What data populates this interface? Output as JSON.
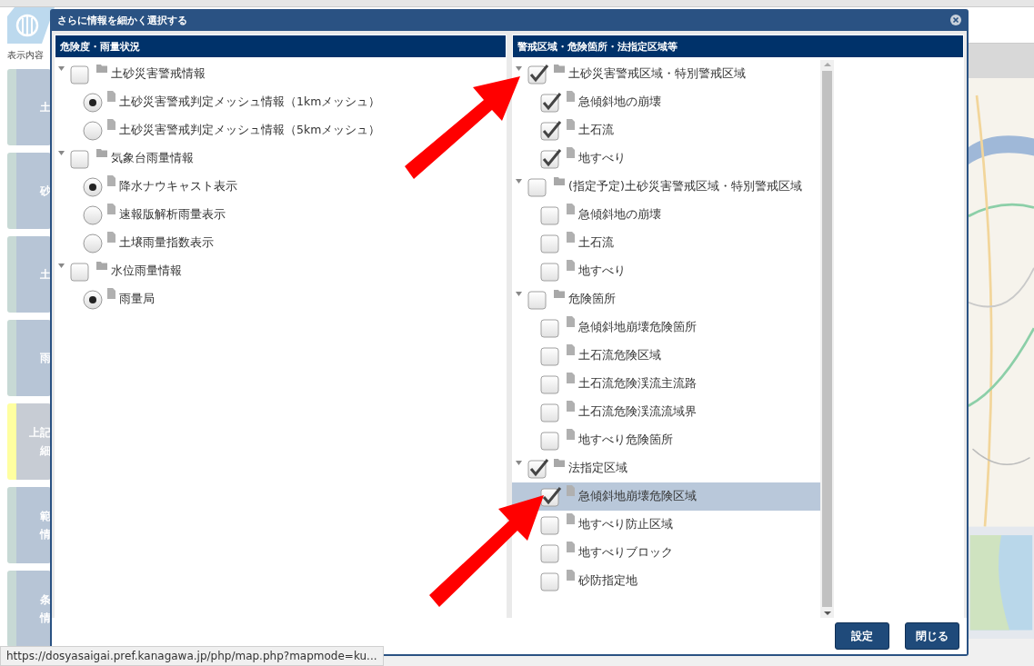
{
  "background": {
    "sidebar_heading": "表示内容",
    "sidebar_items": [
      {
        "lines": [
          "土"
        ],
        "selected": false
      },
      {
        "lines": [
          "砂"
        ],
        "selected": false
      },
      {
        "lines": [
          "土"
        ],
        "selected": false
      },
      {
        "lines": [
          "雨"
        ],
        "selected": false
      },
      {
        "lines": [
          "上記",
          "細"
        ],
        "selected": true
      },
      {
        "lines": [
          "範",
          "情"
        ],
        "selected": false
      },
      {
        "lines": [
          "条",
          "情"
        ],
        "selected": false
      }
    ]
  },
  "dialog": {
    "title": "さらに情報を細かく選択する",
    "panels": [
      {
        "title": "危険度・雨量状況",
        "kind": "plain",
        "tree": [
          {
            "label": "土砂災害警戒情報",
            "checked": false,
            "expanded": true,
            "children": [
              {
                "kind": "radio",
                "label": "土砂災害警戒判定メッシュ情報（1kmメッシュ）",
                "checked": true,
                "selected": false
              },
              {
                "kind": "radio",
                "label": "土砂災害警戒判定メッシュ情報（5kmメッシュ）",
                "checked": false,
                "selected": false
              }
            ]
          },
          {
            "label": "気象台雨量情報",
            "checked": false,
            "expanded": true,
            "children": [
              {
                "kind": "radio",
                "label": "降水ナウキャスト表示",
                "checked": true,
                "selected": false
              },
              {
                "kind": "radio",
                "label": "速報版解析雨量表示",
                "checked": false,
                "selected": false
              },
              {
                "kind": "radio",
                "label": "土壌雨量指数表示",
                "checked": false,
                "selected": false
              }
            ]
          },
          {
            "label": "水位雨量情報",
            "checked": false,
            "expanded": true,
            "children": [
              {
                "kind": "radio",
                "label": "雨量局",
                "checked": true,
                "selected": false
              }
            ]
          }
        ]
      },
      {
        "title": "警戒区域・危険箇所・法指定区域等",
        "kind": "scrolled",
        "tree": [
          {
            "label": "土砂災害警戒区域・特別警戒区域",
            "checked": true,
            "expanded": true,
            "children": [
              {
                "kind": "checkbox",
                "label": "急傾斜地の崩壊",
                "checked": true,
                "selected": false
              },
              {
                "kind": "checkbox",
                "label": "土石流",
                "checked": true,
                "selected": false
              },
              {
                "kind": "checkbox",
                "label": "地すべり",
                "checked": true,
                "selected": false
              }
            ]
          },
          {
            "label": "(指定予定)土砂災害警戒区域・特別警戒区域",
            "checked": false,
            "expanded": true,
            "children": [
              {
                "kind": "checkbox",
                "label": "急傾斜地の崩壊",
                "checked": false,
                "selected": false
              },
              {
                "kind": "checkbox",
                "label": "土石流",
                "checked": false,
                "selected": false
              },
              {
                "kind": "checkbox",
                "label": "地すべり",
                "checked": false,
                "selected": false
              }
            ]
          },
          {
            "label": "危険箇所",
            "checked": false,
            "expanded": true,
            "children": [
              {
                "kind": "checkbox",
                "label": "急傾斜地崩壊危険箇所",
                "checked": false,
                "selected": false
              },
              {
                "kind": "checkbox",
                "label": "土石流危険区域",
                "checked": false,
                "selected": false
              },
              {
                "kind": "checkbox",
                "label": "土石流危険渓流主流路",
                "checked": false,
                "selected": false
              },
              {
                "kind": "checkbox",
                "label": "土石流危険渓流流域界",
                "checked": false,
                "selected": false
              },
              {
                "kind": "checkbox",
                "label": "地すべり危険箇所",
                "checked": false,
                "selected": false
              }
            ]
          },
          {
            "label": "法指定区域",
            "checked": true,
            "expanded": true,
            "children": [
              {
                "kind": "checkbox",
                "label": "急傾斜地崩壊危険区域",
                "checked": true,
                "selected": true
              },
              {
                "kind": "checkbox",
                "label": "地すべり防止区域",
                "checked": false,
                "selected": false
              },
              {
                "kind": "checkbox",
                "label": "地すべりブロック",
                "checked": false,
                "selected": false
              },
              {
                "kind": "checkbox",
                "label": "砂防指定地",
                "checked": false,
                "selected": false
              }
            ]
          }
        ]
      }
    ],
    "buttons": [
      "設定",
      "閉じる"
    ]
  },
  "status_bar": {
    "url": "https://dosyasaigai.pref.kanagawa.jp/php/map.php?mapmode=ku..."
  }
}
